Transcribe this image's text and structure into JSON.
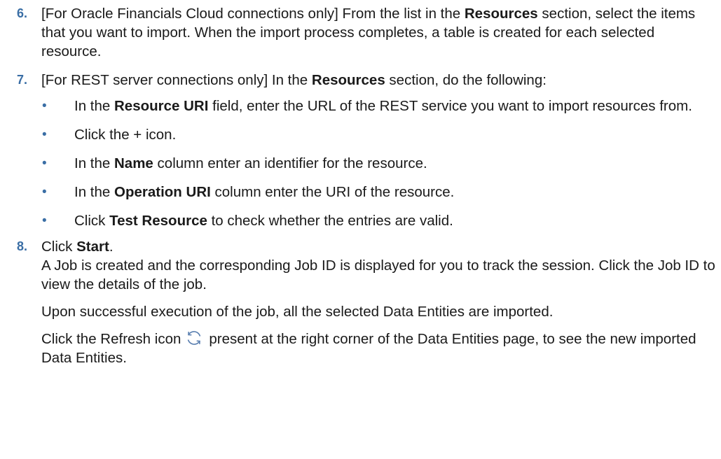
{
  "steps": {
    "s6": {
      "num": "6.",
      "t1": "[For Oracle Financials Cloud connections only] From the list in the ",
      "b1": "Resources",
      "t2": " section, select the items that you want to import. When the import process completes, a table is created for each selected resource."
    },
    "s7": {
      "num": "7.",
      "t1": "[For REST server connections only] In the ",
      "b1": "Resources",
      "t2": " section, do the following:",
      "bullets": [
        {
          "t1": "In the ",
          "b1": "Resource URI",
          "t2": " field, enter the URL of the REST service you want to import resources from."
        },
        {
          "t1": "Click the + icon."
        },
        {
          "t1": "In the ",
          "b1": "Name",
          "t2": " column enter an identifier for the resource."
        },
        {
          "t1": "In the ",
          "b1": "Operation URI",
          "t2": " column enter the URI of the resource."
        },
        {
          "t1": "Click ",
          "b1": "Test Resource",
          "t2": " to check whether the entries are valid."
        }
      ]
    },
    "s8": {
      "num": "8.",
      "t1": "Click ",
      "b1": "Start",
      "t2": ".",
      "desc": "A Job is created and the corresponding Job ID is displayed for you to track the session. Click the Job ID to view the details of the job.",
      "p1": "Upon successful execution of the job, all the selected Data Entities are imported.",
      "p2_before": "Click the Refresh icon",
      "p2_after": "present at the right corner of the Data Entities page, to see the new imported Data Entities."
    }
  },
  "bullet_char": "•",
  "colors": {
    "accent": "#3a6ea5",
    "text": "#1a1a1a",
    "icon": "#5a7fb0"
  },
  "icons": {
    "refresh": "refresh-icon"
  }
}
